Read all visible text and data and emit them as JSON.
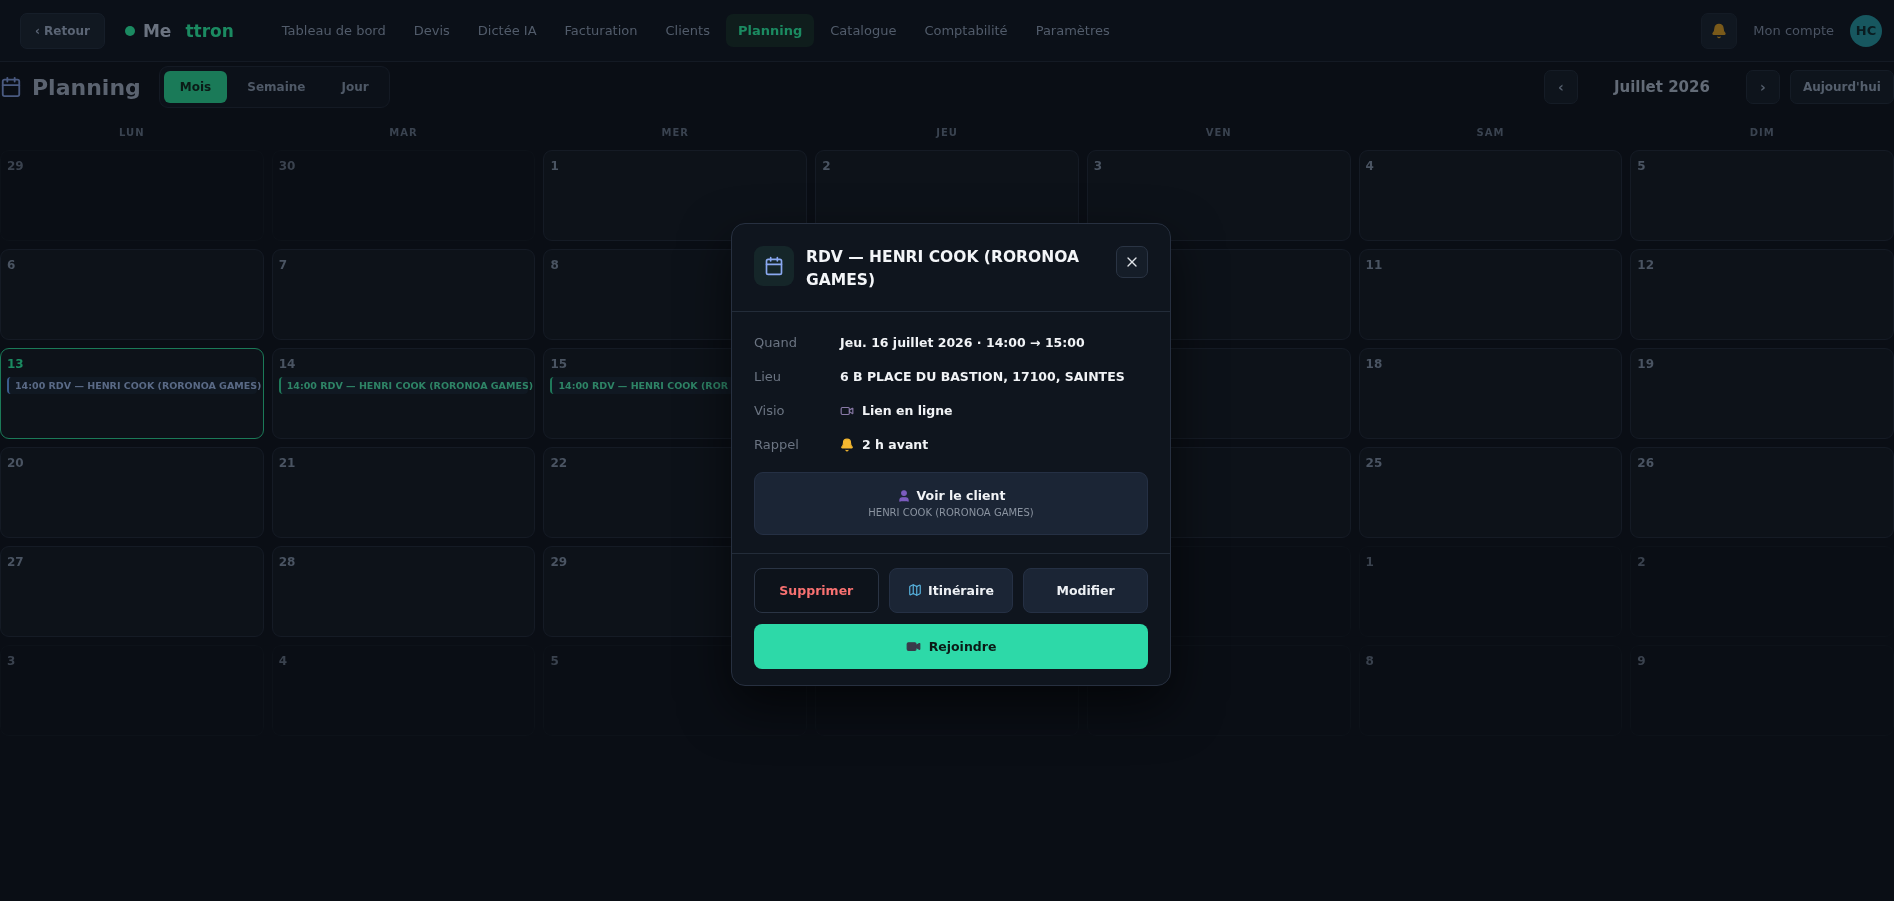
{
  "topbar": {
    "back_label": "‹ Retour",
    "logo": {
      "first": "Me",
      "second": "ttron"
    },
    "nav": [
      {
        "label": "Tableau de bord",
        "selected": false
      },
      {
        "label": "Devis",
        "selected": false
      },
      {
        "label": "Dictée IA",
        "selected": false
      },
      {
        "label": "Facturation",
        "selected": false
      },
      {
        "label": "Clients",
        "selected": false
      },
      {
        "label": "Planning",
        "selected": true
      },
      {
        "label": "Catalogue",
        "selected": false
      },
      {
        "label": "Comptabilité",
        "selected": false
      },
      {
        "label": "Paramètres",
        "selected": false
      }
    ],
    "account_label": "Mon compte",
    "avatar": "HC"
  },
  "header": {
    "title": "Planning",
    "views": [
      {
        "label": "Mois",
        "selected": true
      },
      {
        "label": "Semaine",
        "selected": false
      },
      {
        "label": "Jour",
        "selected": false
      }
    ],
    "prev": "‹",
    "month": "Juillet 2026",
    "next": "›",
    "today_label": "Aujourd'hui"
  },
  "calendar": {
    "weekdays": [
      "LUN",
      "MAR",
      "MER",
      "JEU",
      "VEN",
      "SAM",
      "DIM"
    ],
    "first_week": [
      {
        "day": "29",
        "muted": true,
        "today": false
      },
      {
        "day": "30",
        "muted": true,
        "today": false
      },
      {
        "day": "1",
        "muted": false,
        "today": false
      },
      {
        "day": "2",
        "muted": false,
        "today": false
      },
      {
        "day": "3",
        "muted": false,
        "today": false
      },
      {
        "day": "4",
        "muted": false,
        "today": false
      },
      {
        "day": "5",
        "muted": false,
        "today": false
      }
    ],
    "covered_weeks": [
      {
        "left": [
          {
            "day": "6",
            "muted": false,
            "today": false
          },
          {
            "day": "7",
            "muted": false,
            "today": false
          },
          {
            "day": "8",
            "muted": false,
            "today": false
          }
        ],
        "right": [
          {
            "day": "11",
            "muted": false,
            "today": false
          },
          {
            "day": "12",
            "muted": false,
            "today": false
          }
        ]
      },
      {
        "left": [
          {
            "day": "13",
            "muted": false,
            "today": true,
            "events": [
              {
                "text": "14:00 RDV — HENRI COOK (RORONOA GAMES)",
                "color": "#3b5b8c"
              }
            ]
          },
          {
            "day": "14",
            "muted": false,
            "today": false,
            "events": [
              {
                "text": "14:00 RDV — HENRI COOK (RORONOA GAMES)",
                "color": "#1f7a5a"
              }
            ]
          },
          {
            "day": "15",
            "muted": false,
            "today": false,
            "events": [
              {
                "text": "14:00 RDV — HENRI COOK (ROR",
                "color": "#1f7a5a"
              }
            ]
          }
        ],
        "right": [
          {
            "day": "18",
            "muted": false,
            "today": false
          },
          {
            "day": "19",
            "muted": false,
            "today": false
          }
        ]
      },
      {
        "left": [
          {
            "day": "20",
            "muted": false,
            "today": false
          },
          {
            "day": "21",
            "muted": false,
            "today": false
          },
          {
            "day": "22",
            "muted": false,
            "today": false
          }
        ],
        "right": [
          {
            "day": "25",
            "muted": false,
            "today": false
          },
          {
            "day": "26",
            "muted": false,
            "today": false
          }
        ]
      },
      {
        "left": [
          {
            "day": "27",
            "muted": false,
            "today": false
          },
          {
            "day": "28",
            "muted": false,
            "today": false
          },
          {
            "day": "29",
            "muted": false,
            "today": false
          }
        ],
        "right": [
          {
            "day": "1",
            "muted": true,
            "today": false
          },
          {
            "day": "2",
            "muted": true,
            "today": false
          }
        ]
      },
      {
        "left": [
          {
            "day": "3",
            "muted": true,
            "today": false
          },
          {
            "day": "4",
            "muted": true,
            "today": false
          },
          {
            "day": "5",
            "muted": true,
            "today": false
          }
        ],
        "right": [
          {
            "day": "8",
            "muted": true,
            "today": false
          },
          {
            "day": "9",
            "muted": true,
            "today": false
          }
        ]
      }
    ]
  },
  "modal": {
    "title": "RDV — HENRI COOK (RORONOA GAMES)",
    "details": [
      {
        "label": "Quand",
        "value": "Jeu. 16 juillet 2026 · 14:00 → 15:00"
      },
      {
        "label": "Lieu",
        "value": "6 B PLACE DU BASTION, 17100, SAINTES"
      },
      {
        "label": "Visio",
        "value": "Lien en ligne"
      },
      {
        "label": "Rappel",
        "value": "2 h avant"
      }
    ],
    "client": {
      "label": "Voir le client",
      "name": "HENRI COOK (RORONOA GAMES)"
    },
    "actions": [
      {
        "label": "Supprimer",
        "kind": "danger"
      },
      {
        "label": "Itinéraire",
        "kind": "map"
      },
      {
        "label": "Modifier",
        "kind": "plain"
      }
    ],
    "join_label": "Rejoindre"
  }
}
